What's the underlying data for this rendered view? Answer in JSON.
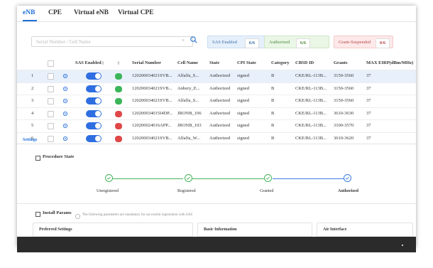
{
  "tabs": [
    {
      "label": "eNB",
      "active": true
    },
    {
      "label": "CPE",
      "active": false
    },
    {
      "label": "Virtual eNB",
      "active": false
    },
    {
      "label": "Virtual CPE",
      "active": false
    }
  ],
  "search": {
    "placeholder": "Serial Number / Cell Name",
    "clear_icon": "close-icon",
    "search_icon": "search-icon"
  },
  "filters": {
    "sas": {
      "label": "SAS Enabled",
      "count": "6/6"
    },
    "authorized": {
      "label": "Authorized",
      "count": "6/6"
    },
    "grant": {
      "label": "Grant-Suspended",
      "count": "0/6"
    }
  },
  "columns": [
    "SAS Enabled",
    "Serial Number",
    "Cell Name",
    "State",
    "CPI State",
    "Category",
    "CBSD ID",
    "Grants",
    "MAX EIRP(dBm/MHz)"
  ],
  "rows": [
    {
      "num": "1",
      "serial": "120200034021SVB...",
      "cell": "Alfalfa_S...",
      "state": "Authorized",
      "cpi": "signed",
      "cat": "B",
      "cbsd": "CKE/RL-113B...",
      "grants": "3150-3560",
      "eirp": "37",
      "badge": "ok",
      "selected": true
    },
    {
      "num": "2",
      "serial": "120200034021SVB...",
      "cell": "Anbery_E...",
      "state": "Authorized",
      "cpi": "signed",
      "cat": "B",
      "cbsd": "CKE/RL-113B...",
      "grants": "3150-3560",
      "eirp": "37",
      "badge": "ok",
      "selected": false
    },
    {
      "num": "3",
      "serial": "120200034021SVB...",
      "cell": "Alfalfa_S...",
      "state": "Authorized",
      "cpi": "signed",
      "cat": "B",
      "cbsd": "CKE/RL-113B...",
      "grants": "3150-3560",
      "eirp": "37",
      "badge": "ok",
      "selected": false
    },
    {
      "num": "4",
      "serial": "120200034015I4DP...",
      "cell": "JRONB_106",
      "state": "Authorized",
      "cpi": "signed",
      "cat": "B",
      "cbsd": "CKE/RL-113B...",
      "grants": "3610-3630",
      "eirp": "37",
      "badge": "err",
      "selected": false
    },
    {
      "num": "5",
      "serial": "120200024016APP...",
      "cell": "JRONB_103",
      "state": "Authorized",
      "cpi": "signed",
      "cat": "B",
      "cbsd": "CKE/RL-113B...",
      "grants": "3100-3570",
      "eirp": "37",
      "badge": "err",
      "selected": false
    },
    {
      "num": "6",
      "serial": "120200034021SVB...",
      "cell": "Alfalfa_W...",
      "state": "Authorized",
      "cpi": "signed",
      "cat": "B",
      "cbsd": "CKE/RL-113B...",
      "grants": "3610-3620",
      "eirp": "37",
      "badge": "err",
      "selected": false
    }
  ],
  "settings_link": "Settings",
  "procedure": {
    "title": "Procedure State",
    "steps": [
      "Unregistered",
      "Registered",
      "Granted",
      "Authorized"
    ]
  },
  "install": {
    "title": "Install Params",
    "hint": "The following parameters are mandatory for successful registration with SAS",
    "panels": [
      "Preferred Settings",
      "Basic Information",
      "Air Interface"
    ]
  },
  "colors": {
    "accent": "#1f6fd6",
    "toggle_on": "#2f6ee0",
    "ok": "#3cb55a",
    "err": "#e04848",
    "selected_row": "#e8f0fb"
  }
}
